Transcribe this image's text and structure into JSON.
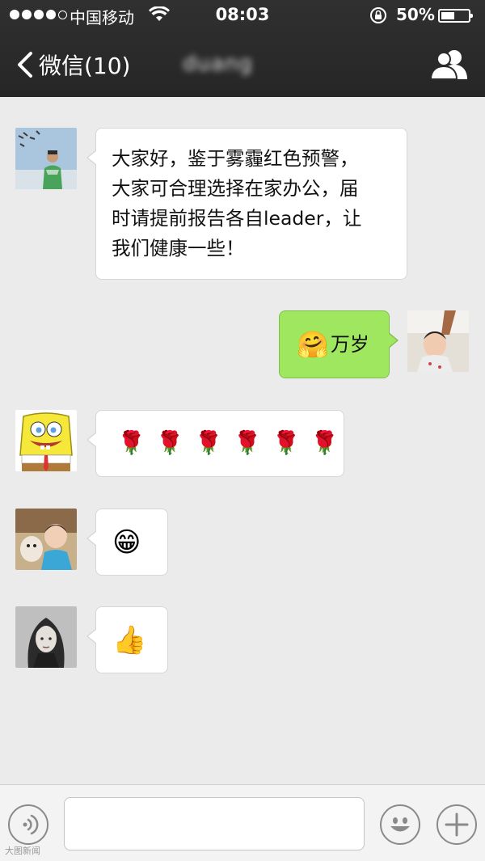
{
  "status_bar": {
    "carrier": "中国移动",
    "time": "08:03",
    "battery": "50%",
    "battery_level": 0.5
  },
  "nav": {
    "back_label": "微信(10)",
    "title": "duang"
  },
  "messages": [
    {
      "side": "left",
      "text_lines": [
        "大家好，鉴于雾霾红色预警，",
        "大家可合理选择在家办公，届",
        "时请提前报告各自leader，让",
        "我们健康一些！"
      ]
    },
    {
      "side": "right",
      "emoji": "🤗",
      "text": "万岁"
    },
    {
      "side": "left",
      "emoji": "🌹🌹🌹🌹🌹🌹"
    },
    {
      "side": "left",
      "emoji": "😁"
    },
    {
      "side": "left",
      "emoji": "👍"
    }
  ],
  "input_bar": {
    "placeholder": ""
  },
  "watermark": "大图新闻"
}
